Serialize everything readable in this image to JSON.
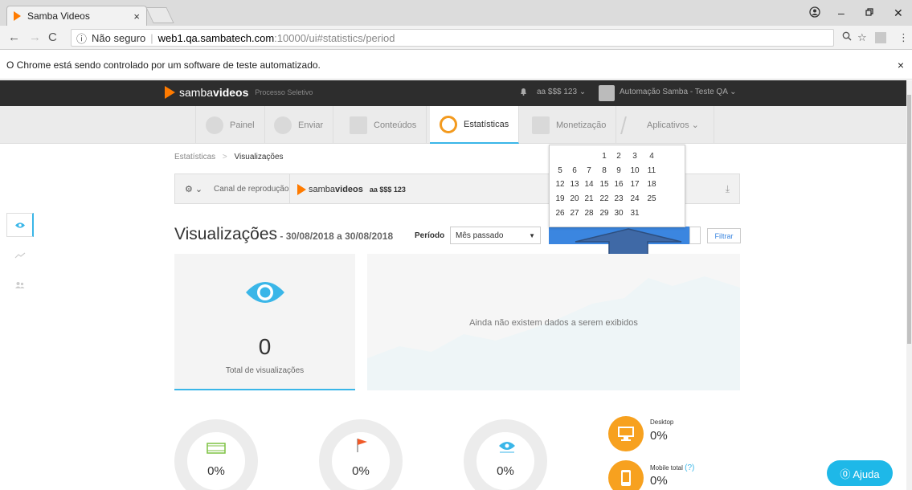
{
  "browser": {
    "tab_title": "Samba Videos",
    "tab_close": "×",
    "security_label": "Não seguro",
    "url_host": "web1.qa.sambatech.com",
    "url_path": ":10000/ui#statistics/period",
    "automation_notice": "O Chrome está sendo controlado por um software de teste automatizado.",
    "notice_close": "×"
  },
  "header": {
    "logo_light": "samba",
    "logo_bold": "videos",
    "logo_subtitle": "Processo Seletivo",
    "project": "aa $$$ 123",
    "user": "Automação Samba - Teste QA"
  },
  "nav": {
    "items": [
      {
        "label": "Painel"
      },
      {
        "label": "Enviar"
      },
      {
        "label": "Conteúdos"
      },
      {
        "label": "Estatísticas"
      },
      {
        "label": "Monetização"
      },
      {
        "label": "Aplicativos"
      }
    ]
  },
  "breadcrumb": {
    "root": "Estatísticas",
    "separator": ">",
    "current": "Visualizações"
  },
  "channel": {
    "label": "Canal de reprodução",
    "logo_light": "samba",
    "logo_bold": "videos",
    "name": "aa $$$ 123"
  },
  "page": {
    "title": "Visualizações",
    "date_range": " - 30/08/2018 a 30/08/2018",
    "period_label": "Período",
    "period_value": "Mês passado",
    "filter_button": "Filtrar"
  },
  "calendar": {
    "rows": [
      [
        "",
        "",
        "",
        "1",
        "2",
        "3",
        "4"
      ],
      [
        "5",
        "6",
        "7",
        "8",
        "9",
        "10",
        "11"
      ],
      [
        "12",
        "13",
        "14",
        "15",
        "16",
        "17",
        "18"
      ],
      [
        "19",
        "20",
        "21",
        "22",
        "23",
        "24",
        "25"
      ],
      [
        "26",
        "27",
        "28",
        "29",
        "30",
        "31",
        ""
      ]
    ]
  },
  "views_card": {
    "total": "0",
    "label": "Total de visualizações"
  },
  "chart": {
    "empty_message": "Ainda não existem dados a serem exibidos"
  },
  "rings": [
    {
      "value": "0%"
    },
    {
      "value": "0%"
    },
    {
      "value": "0%"
    }
  ],
  "devices": {
    "desktop_label": "Desktop",
    "desktop_value": "0%",
    "mobile_label": "Mobile total",
    "mobile_help": "(?)",
    "mobile_value": "0%"
  },
  "help_button": "⓪ Ajuda",
  "colors": {
    "accent": "#3ab6e8",
    "brand": "#ff7b00",
    "device": "#f7a11f",
    "button": "#3b86e0"
  }
}
